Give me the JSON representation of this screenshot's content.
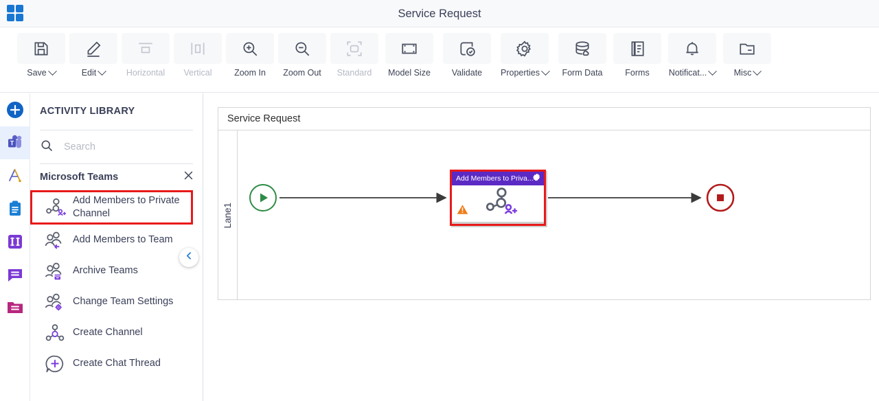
{
  "window": {
    "title": "Service Request",
    "app_icon": "grid-apps-icon"
  },
  "toolbar": {
    "items": [
      {
        "label": "Save",
        "icon": "save-icon",
        "caret": true,
        "disabled": false
      },
      {
        "label": "Edit",
        "icon": "edit-pencil-icon",
        "caret": true,
        "disabled": false
      },
      {
        "label": "Horizontal",
        "icon": "horizontal-layout-icon",
        "caret": false,
        "disabled": true
      },
      {
        "label": "Vertical",
        "icon": "vertical-layout-icon",
        "caret": false,
        "disabled": true
      },
      {
        "label": "Zoom In",
        "icon": "zoom-in-icon",
        "caret": false,
        "disabled": false
      },
      {
        "label": "Zoom Out",
        "icon": "zoom-out-icon",
        "caret": false,
        "disabled": false
      },
      {
        "label": "Standard",
        "icon": "standard-size-icon",
        "caret": false,
        "disabled": true
      },
      {
        "label": "Model Size",
        "icon": "model-size-icon",
        "caret": false,
        "disabled": false
      },
      {
        "label": "Validate",
        "icon": "validate-icon",
        "caret": false,
        "disabled": false
      },
      {
        "label": "Properties",
        "icon": "gear-icon",
        "caret": true,
        "disabled": false
      },
      {
        "label": "Form Data",
        "icon": "database-icon",
        "caret": false,
        "disabled": false
      },
      {
        "label": "Forms",
        "icon": "forms-document-icon",
        "caret": false,
        "disabled": false
      },
      {
        "label": "Notificat...",
        "icon": "bell-icon",
        "caret": true,
        "disabled": false
      },
      {
        "label": "Misc",
        "icon": "folder-icon",
        "caret": true,
        "disabled": false
      }
    ]
  },
  "rail": {
    "items": [
      {
        "icon": "add-plus-circle-icon",
        "active": false
      },
      {
        "icon": "microsoft-teams-icon",
        "active": true
      },
      {
        "icon": "compass-drafting-icon",
        "active": false
      },
      {
        "icon": "clipboard-icon",
        "active": false
      },
      {
        "icon": "columns-icon",
        "active": false
      },
      {
        "icon": "chat-bubble-icon",
        "active": false
      },
      {
        "icon": "folder-pink-icon",
        "active": false
      }
    ]
  },
  "library": {
    "heading": "ACTIVITY LIBRARY",
    "search": {
      "value": "",
      "placeholder": "Search",
      "icon": "search-icon"
    },
    "group": {
      "name": "Microsoft Teams",
      "close_icon": "close-x-icon"
    },
    "activities": [
      {
        "label": "Add Members to Private Channel",
        "icon": "add-members-private-channel-icon",
        "selected": true
      },
      {
        "label": "Add Members to Team",
        "icon": "add-members-team-icon",
        "selected": false
      },
      {
        "label": "Archive Teams",
        "icon": "archive-teams-icon",
        "selected": false
      },
      {
        "label": "Change Team Settings",
        "icon": "change-team-settings-icon",
        "selected": false
      },
      {
        "label": "Create Channel",
        "icon": "create-channel-icon",
        "selected": false
      },
      {
        "label": "Create Chat Thread",
        "icon": "create-chat-thread-icon",
        "selected": false
      }
    ],
    "collapse_icon": "chevron-left-icon"
  },
  "canvas": {
    "pool_title": "Service Request",
    "lane_label": "Lane1",
    "start_event": {
      "icon": "start-play-icon"
    },
    "end_event": {
      "icon": "end-stop-icon"
    },
    "activity": {
      "title": "Add Members to Priva...",
      "gear_icon": "gear-icon",
      "warning_icon": "warning-triangle-icon",
      "body_icon": "add-members-private-channel-icon"
    }
  },
  "colors": {
    "accent_blue": "#1877d2",
    "selection_red": "#e8191a",
    "node_purple": "#5b2ac4",
    "start_green": "#2e8b45",
    "end_red": "#b31b1b",
    "warning_orange": "#ef7d1a",
    "teams_purple": "#6b4fc9"
  }
}
